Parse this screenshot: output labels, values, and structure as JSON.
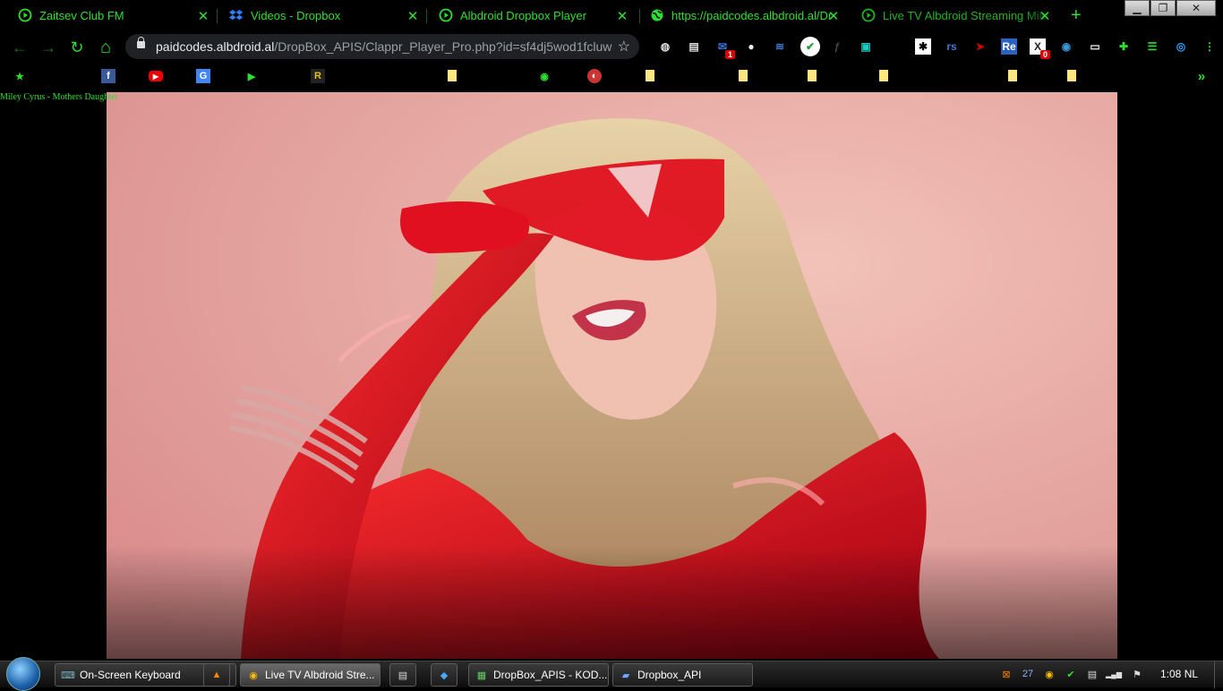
{
  "tabs": [
    {
      "label": "Zaitsev Club FM",
      "icon": "play-circle-icon",
      "active": false
    },
    {
      "label": "Videos - Dropbox",
      "icon": "dropbox-icon",
      "active": false
    },
    {
      "label": "Albdroid Dropbox Player",
      "icon": "play-circle-icon",
      "active": false
    },
    {
      "label": "https://paidcodes.albdroid.al/Dr",
      "icon": "globe-icon",
      "active": false
    },
    {
      "label": "Live TV Albdroid Streaming Mile",
      "icon": "play-circle-icon",
      "active": true
    }
  ],
  "tab_close_glyph": "✕",
  "new_tab_glyph": "+",
  "window_controls": {
    "minimize": "▁",
    "maximize": "❐",
    "close": "✕"
  },
  "address": {
    "domain": "paidcodes.albdroid.al",
    "path": "/DropBox_APIS/Clappr_Player_Pro.php?id=sf4dj5wod1fcluw",
    "star": "☆"
  },
  "nav": {
    "back": "←",
    "forward": "→",
    "reload": "↻",
    "home": "⌂"
  },
  "extensions": [
    {
      "icon": "globe-icon",
      "text": "◍",
      "color": "#ddd",
      "badge": ""
    },
    {
      "icon": "document-icon",
      "text": "▤",
      "color": "#ddd",
      "badge": ""
    },
    {
      "icon": "mail-icon",
      "text": "✉",
      "color": "#3b6fd9",
      "badge": "1"
    },
    {
      "icon": "github-icon",
      "text": "●",
      "color": "#eee",
      "badge": ""
    },
    {
      "icon": "layers-icon",
      "text": "≋",
      "color": "#3b7bd9",
      "badge": ""
    },
    {
      "icon": "check-circle-icon",
      "text": "✔",
      "color": "#2b9a3c",
      "badge": ""
    },
    {
      "icon": "key-icon",
      "text": "ƒ",
      "color": "#444",
      "badge": ""
    },
    {
      "icon": "chip-icon",
      "text": "▣",
      "color": "#1ccac0",
      "badge": ""
    },
    {
      "icon": "asterisk-icon",
      "text": "✱",
      "color": "#000",
      "badge": ""
    },
    {
      "icon": "rs-icon",
      "text": "rs",
      "color": "#3b7bd9",
      "badge": ""
    },
    {
      "icon": "arrow-icon",
      "text": "➤",
      "color": "#c00",
      "badge": ""
    },
    {
      "icon": "re-icon",
      "text": "Re",
      "color": "#fff",
      "badge": ""
    },
    {
      "icon": "x-icon",
      "text": "X",
      "color": "#222",
      "badge": "0"
    },
    {
      "icon": "earth-icon",
      "text": "◉",
      "color": "#3a9ad9",
      "badge": ""
    },
    {
      "icon": "printer-icon",
      "text": "▭",
      "color": "#eee",
      "badge": ""
    },
    {
      "icon": "puzzle-icon",
      "text": "✚",
      "color": "#2ee02e",
      "badge": ""
    },
    {
      "icon": "playlist-icon",
      "text": "☰",
      "color": "#2ee02e",
      "badge": ""
    },
    {
      "icon": "profile-icon",
      "text": "◎",
      "color": "#29a3ff",
      "badge": ""
    },
    {
      "icon": "menu-icon",
      "text": "⋮",
      "color": "#2ee02e",
      "badge": ""
    }
  ],
  "bookmarks": [
    {
      "icon": "star-icon",
      "text": "★",
      "color": "#2ee02e"
    },
    {
      "icon": "facebook-icon",
      "text": "f",
      "color": "#fff"
    },
    {
      "icon": "youtube-icon",
      "text": "▶",
      "color": "#fff"
    },
    {
      "icon": "translate-icon",
      "text": "G",
      "color": "#fff"
    },
    {
      "icon": "play-circle-icon",
      "text": "▶",
      "color": "#2ee02e"
    },
    {
      "icon": "r-icon",
      "text": "R",
      "color": "#e8c020"
    },
    {
      "icon": "note-icon",
      "text": "",
      "color": ""
    },
    {
      "icon": "globe-icon",
      "text": "◉",
      "color": "#2ee02e"
    },
    {
      "icon": "radio-icon",
      "text": "◐",
      "color": "#fff"
    },
    {
      "icon": "note-icon",
      "text": "",
      "color": ""
    },
    {
      "icon": "note-icon",
      "text": "",
      "color": ""
    },
    {
      "icon": "note-icon",
      "text": "",
      "color": ""
    },
    {
      "icon": "note-icon",
      "text": "",
      "color": ""
    },
    {
      "icon": "note-icon",
      "text": "",
      "color": ""
    },
    {
      "icon": "note-icon",
      "text": "",
      "color": ""
    }
  ],
  "bookmarks_overflow": "»",
  "video": {
    "title": "Miley Cyrus - Mothers Daughter"
  },
  "taskbar": {
    "buttons": [
      {
        "label": "On-Screen Keyboard",
        "icon": "keyboard-icon",
        "glyph": "⌨",
        "active": false
      },
      {
        "label": "",
        "icon": "vlc-icon",
        "glyph": "▲",
        "active": false
      },
      {
        "label": "Live TV Albdroid Stre...",
        "icon": "chrome-icon",
        "glyph": "◉",
        "active": true
      },
      {
        "label": "",
        "icon": "notepad-icon",
        "glyph": "▤",
        "active": false
      },
      {
        "label": "",
        "icon": "diamond-icon",
        "glyph": "◆",
        "active": false
      },
      {
        "label": "DropBox_APIS - KOD...",
        "icon": "editor-icon",
        "glyph": "▦",
        "active": false
      },
      {
        "label": "Dropbox_API",
        "icon": "folder-icon",
        "glyph": "▰",
        "active": false
      }
    ],
    "tray": [
      {
        "icon": "xampp-icon",
        "glyph": "⊠",
        "color": "#f57c00"
      },
      {
        "icon": "sync-icon",
        "glyph": "27",
        "color": "#8ab4f8"
      },
      {
        "icon": "chrome-icon",
        "glyph": "◉",
        "color": "#fbbc04"
      },
      {
        "icon": "shield-icon",
        "glyph": "✔",
        "color": "#2ee02e"
      },
      {
        "icon": "clipboard-icon",
        "glyph": "▤",
        "color": "#ddd"
      },
      {
        "icon": "network-icon",
        "glyph": "▂▄▆",
        "color": "#ddd"
      },
      {
        "icon": "flag-icon",
        "glyph": "⚑",
        "color": "#ddd"
      }
    ],
    "clock": "1:08 NL"
  }
}
